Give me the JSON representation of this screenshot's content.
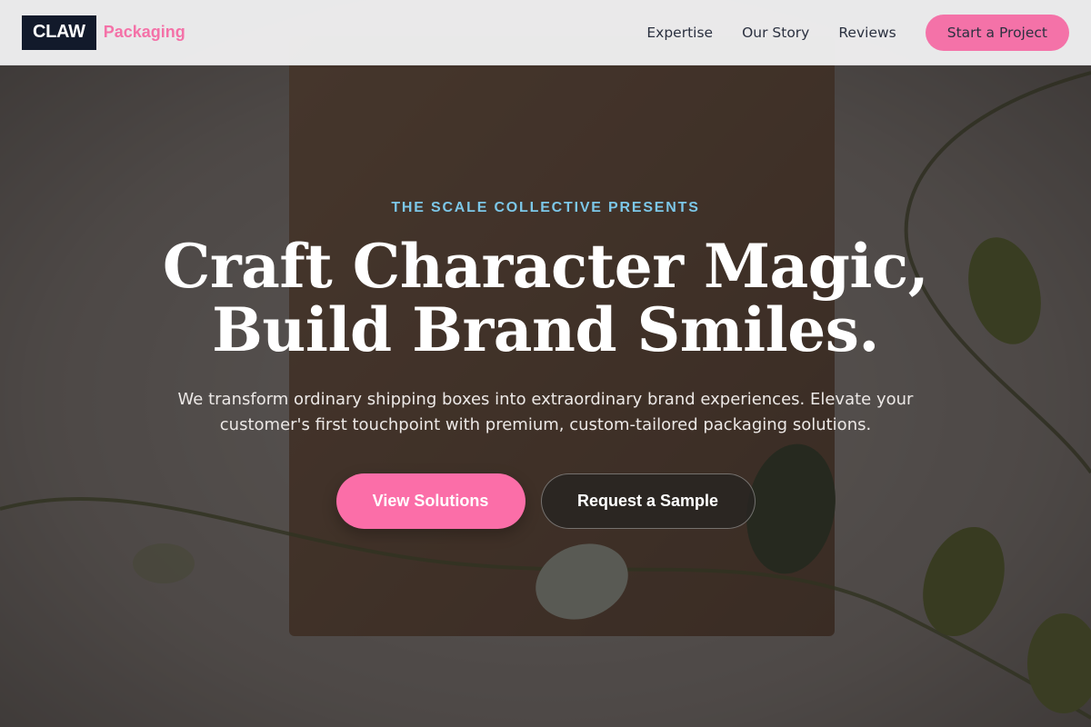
{
  "header": {
    "logo_box": "CLAW",
    "logo_text": "Packaging",
    "nav": [
      {
        "label": "Expertise"
      },
      {
        "label": "Our Story"
      },
      {
        "label": "Reviews"
      }
    ],
    "cta_label": "Start a Project"
  },
  "hero": {
    "eyebrow": "THE SCALE COLLECTIVE PRESENTS",
    "headline_line1": "Craft Character Magic,",
    "headline_line2": "Build Brand Smiles.",
    "subtext": "We transform ordinary shipping boxes into extraordinary brand experiences. Elevate your customer's first touchpoint with premium, custom-tailored packaging solutions.",
    "primary_button": "View Solutions",
    "secondary_button": "Request a Sample",
    "background_image": "kraft-box-with-plant-icon"
  },
  "colors": {
    "brand_pink": "#f472a8",
    "logo_navy": "#121a2b",
    "eyebrow_blue": "#7cc7e8"
  }
}
